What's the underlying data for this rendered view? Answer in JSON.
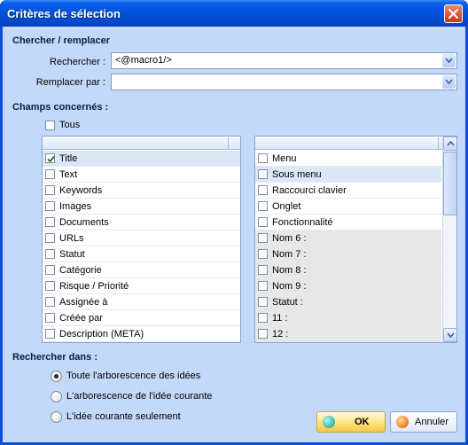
{
  "window": {
    "title": "Critères de sélection"
  },
  "search": {
    "section": "Chercher / remplacer",
    "find_label": "Rechercher :",
    "find_value": "<@macro1/>",
    "replace_label": "Remplacer par :",
    "replace_value": ""
  },
  "fields": {
    "section": "Champs concernés :",
    "all_label": "Tous",
    "all_checked": false,
    "left": [
      {
        "label": "Title",
        "checked": true,
        "selected": true
      },
      {
        "label": "Text",
        "checked": false
      },
      {
        "label": "Keywords",
        "checked": false
      },
      {
        "label": "Images",
        "checked": false
      },
      {
        "label": "Documents",
        "checked": false
      },
      {
        "label": "URLs",
        "checked": false
      },
      {
        "label": "Statut",
        "checked": false
      },
      {
        "label": "Catégorie",
        "checked": false
      },
      {
        "label": "Risque / Priorité",
        "checked": false
      },
      {
        "label": "Assignée à",
        "checked": false
      },
      {
        "label": "Créée par",
        "checked": false
      },
      {
        "label": "Description (META)",
        "checked": false
      }
    ],
    "right": [
      {
        "label": "Menu",
        "checked": false
      },
      {
        "label": "Sous menu",
        "checked": false,
        "selected": true
      },
      {
        "label": "Raccourci clavier",
        "checked": false
      },
      {
        "label": "Onglet",
        "checked": false
      },
      {
        "label": "Fonctionnalité",
        "checked": false
      },
      {
        "label": "Nom 6 :",
        "checked": false,
        "disabled": true
      },
      {
        "label": "Nom 7 :",
        "checked": false,
        "disabled": true
      },
      {
        "label": "Nom 8 :",
        "checked": false,
        "disabled": true
      },
      {
        "label": "Nom 9 :",
        "checked": false,
        "disabled": true
      },
      {
        "label": "Statut :",
        "checked": false,
        "disabled": true
      },
      {
        "label": "11 :",
        "checked": false,
        "disabled": true
      },
      {
        "label": "12 :",
        "checked": false,
        "disabled": true
      }
    ]
  },
  "scope": {
    "section": "Rechercher dans :",
    "options": [
      {
        "label": "Toute l'arborescence des idées",
        "selected": true
      },
      {
        "label": "L'arborescence de l'idée courante",
        "selected": false
      },
      {
        "label": "L'idée courante seulement",
        "selected": false
      }
    ]
  },
  "buttons": {
    "ok": "OK",
    "cancel": "Annuler"
  },
  "colors": {
    "titlebar": "#0050d8",
    "client": "#c3d9f9",
    "ok_icon": "#3cc2b4",
    "cancel_icon": "#f08a20",
    "section_text": "#0b1b45"
  },
  "icons": {
    "close": "close-icon",
    "dropdown": "chevron-down-icon",
    "ok": "ok-circle-icon",
    "cancel": "cancel-circle-icon"
  }
}
